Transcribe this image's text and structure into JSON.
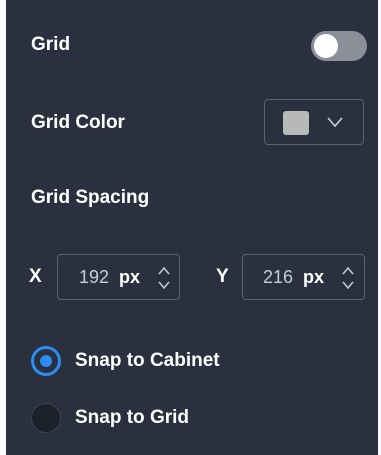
{
  "grid": {
    "label": "Grid",
    "enabled": false
  },
  "grid_color": {
    "label": "Grid Color",
    "swatch_color": "#b8b8b8",
    "dropdown_icon": "chevron-down-icon"
  },
  "grid_spacing": {
    "label": "Grid Spacing",
    "x": {
      "axis_label": "X",
      "value": "192",
      "unit": "px"
    },
    "y": {
      "axis_label": "Y",
      "value": "216",
      "unit": "px"
    }
  },
  "snap": {
    "options": [
      {
        "label": "Snap to Cabinet",
        "selected": true
      },
      {
        "label": "Snap to Grid",
        "selected": false
      }
    ]
  },
  "colors": {
    "panel_bg": "#2a303d",
    "accent": "#2b8cf3",
    "border": "#5b6271",
    "toggle_off": "#8a8f99"
  }
}
